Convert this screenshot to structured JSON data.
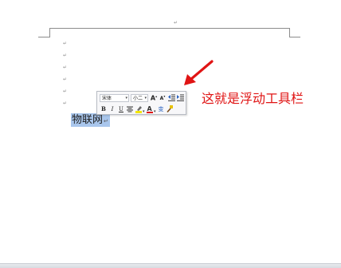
{
  "document": {
    "header_mark": "↵",
    "paragraph_mark": "↵",
    "selected_text": "物联网",
    "selected_end_mark": "↵"
  },
  "mini_toolbar": {
    "font_name": "宋体",
    "font_size": "小二",
    "buttons": {
      "grow_font_label": "A",
      "shrink_font_label": "A",
      "bold_label": "B",
      "italic_label": "I",
      "underline_label": "U",
      "font_color_label": "A",
      "phonetic_label": "变"
    },
    "icons": [
      "grow-font-icon",
      "shrink-font-icon",
      "decrease-indent-icon",
      "increase-indent-icon",
      "center-align-icon",
      "highlight-icon",
      "font-color-icon",
      "phonetic-guide-icon",
      "format-painter-icon"
    ]
  },
  "annotation": {
    "text": "这就是浮动工具栏",
    "color": "#e01414"
  },
  "colors": {
    "selection": "#a9c6ec",
    "toolbar_bg": "#f7f7f9",
    "annotation": "#e01414"
  }
}
